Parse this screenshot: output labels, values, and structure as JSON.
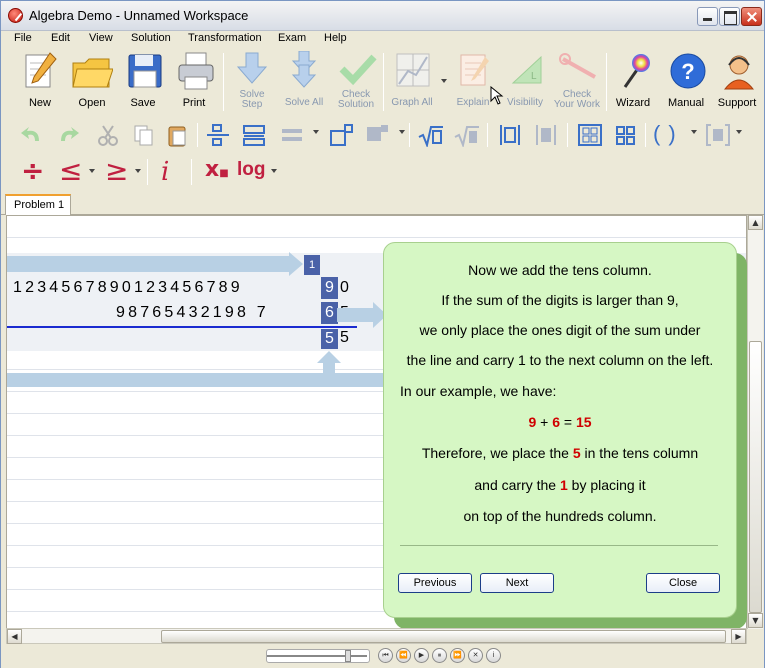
{
  "window": {
    "title": "Algebra Demo - Unnamed Workspace"
  },
  "menu": [
    "File",
    "Edit",
    "View",
    "Solution",
    "Transformation",
    "Exam",
    "Help"
  ],
  "toolbar": {
    "new": "New",
    "open": "Open",
    "save": "Save",
    "print": "Print",
    "solve_step_1": "Solve",
    "solve_step_2": "Step",
    "solve_all": "Solve All",
    "check_solution_1": "Check",
    "check_solution_2": "Solution",
    "graph_all": "Graph All",
    "explain": "Explain",
    "visibility": "Visibility",
    "check_work_1": "Check",
    "check_work_2": "Your Work",
    "wizard": "Wizard",
    "manual": "Manual",
    "support": "Support"
  },
  "symbols": {
    "divide": "÷",
    "leq": "≤",
    "geq": "≥",
    "imag": "i",
    "subscript": "x",
    "log": "log",
    "paren_open": "(",
    "paren_close": ")"
  },
  "tabs": [
    "Problem 1"
  ],
  "workspace": {
    "carry_digit": "1",
    "row1_digits": "1234567890123456789",
    "row1_highlight": "9",
    "row1_tail": "0",
    "row2_digits": "98765432198 7",
    "row2_highlight": "6",
    "row2_tail": "5",
    "result_highlight": "5",
    "result_tail": "5"
  },
  "explanation": {
    "lines": [
      "Now we add the tens column.",
      "If the sum of the digits is larger than 9,",
      "we only place the ones digit of the sum under",
      "the line and carry 1 to the next column on the left.",
      "In our example, we have:"
    ],
    "equation": {
      "a": "9",
      "plus": " + ",
      "b": "6",
      "eq": " = ",
      "sum": "15"
    },
    "line6_pre": "Therefore, we place the ",
    "line6_num": "5",
    "line6_post": " in the tens column",
    "line7_pre": "and carry the ",
    "line7_num": "1",
    "line7_post": " by placing it",
    "line8": "on top of the hundreds column.",
    "previous": "Previous",
    "next": "Next",
    "close": "Close"
  },
  "colors": {
    "highlight": "#4a62a8",
    "bubble": "#d6f7c4",
    "red": "#d00000",
    "line": "#1a2bd0"
  }
}
